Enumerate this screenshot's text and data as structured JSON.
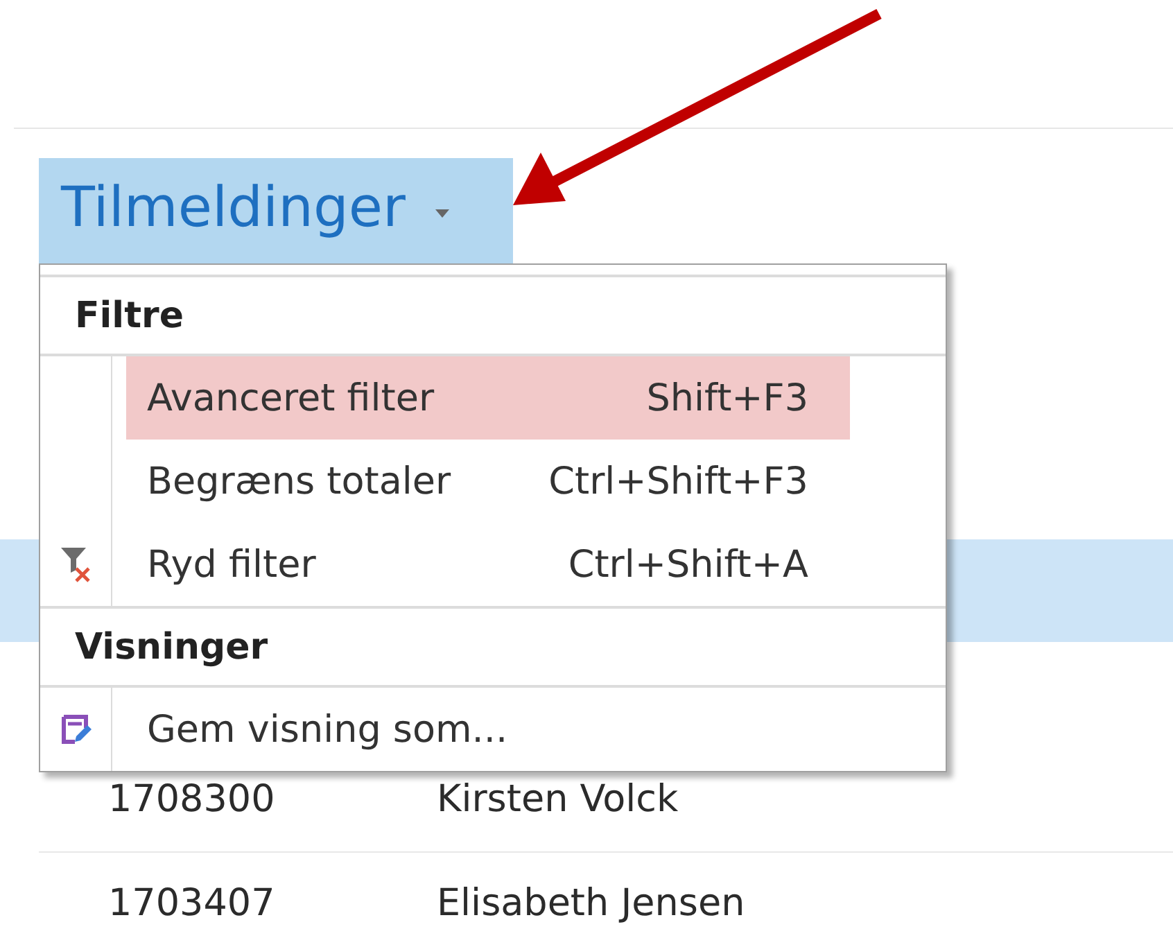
{
  "view_title": {
    "label": "Tilmeldinger",
    "open": true
  },
  "rows": [
    {
      "selected": true
    },
    {
      "number": "1708300",
      "name": "Kirsten Volck",
      "selected": false
    },
    {
      "number": "1703407",
      "name": "Elisabeth Jensen",
      "selected": false
    }
  ],
  "menu": [
    {
      "kind": "header",
      "label": "Filtre"
    },
    {
      "kind": "item",
      "label": "Avanceret filter",
      "shortcut": "Shift+F3",
      "highlighted": true
    },
    {
      "kind": "item",
      "label": "Begræns totaler",
      "shortcut": "Ctrl+Shift+F3",
      "highlighted": false
    },
    {
      "kind": "clear-action",
      "label": "Ryd filter",
      "shortcut": "Ctrl+Shift+A",
      "highlighted": false
    },
    {
      "kind": "header",
      "label": "Visninger"
    },
    {
      "kind": "save-action",
      "label": "Gem visning som...",
      "highlighted": false
    }
  ],
  "annotation": {
    "kind": "arrow"
  }
}
